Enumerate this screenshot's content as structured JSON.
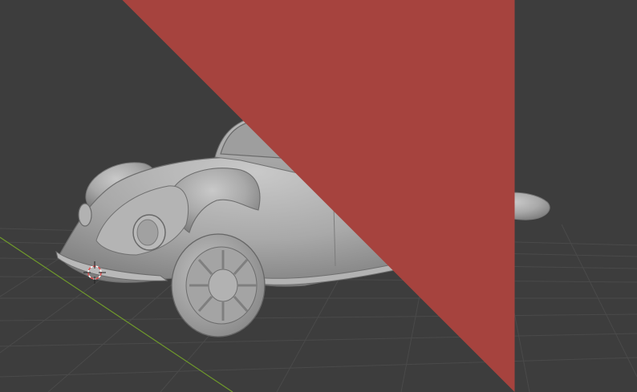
{
  "viewport": {
    "mode": "solid-shading",
    "background_color": "#3d3d3d",
    "grid_color": "#4a4a4a",
    "axis_x_color": "#a6433e",
    "axis_y_color": "#6f9a2b",
    "model_color": "#a8a8a8"
  },
  "scene": {
    "object_name": "",
    "icons": [
      "3d-cursor-icon"
    ]
  }
}
